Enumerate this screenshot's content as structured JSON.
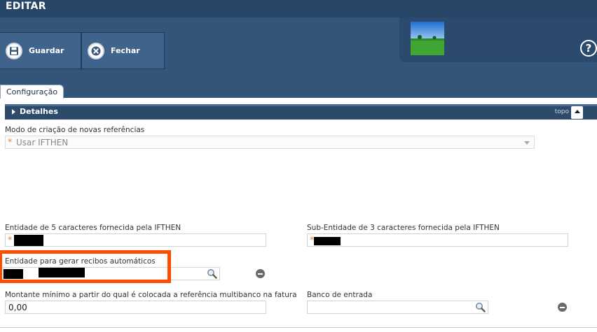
{
  "page": {
    "title": "EDITAR"
  },
  "toolbar": {
    "save_label": "Guardar",
    "close_label": "Fechar"
  },
  "header": {
    "help_label": "?"
  },
  "tabs": [
    {
      "label": "Configuração"
    }
  ],
  "section": {
    "title": "Detalhes",
    "top_link": "topo"
  },
  "fields": {
    "mode": {
      "label": "Modo de criação de novas referências",
      "value": "Usar IFTHEN"
    },
    "entity": {
      "label": "Entidade de 5 caracteres fornecida pela IFTHEN"
    },
    "subentity": {
      "label": "Sub-Entidade de 3 caracteres fornecida pela IFTHEN"
    },
    "receipt_entity": {
      "label": "Entidade para gerar recibos automáticos"
    },
    "min_amount": {
      "label": "Montante mínimo a partir do qual é colocada a referência multibanco na fatura",
      "value": "0,00"
    },
    "bank": {
      "label": "Banco de entrada"
    }
  },
  "colors": {
    "header": "#34557a",
    "section": "#2d4a6b",
    "highlight": "#ff4d00",
    "required": "#f0a060"
  }
}
